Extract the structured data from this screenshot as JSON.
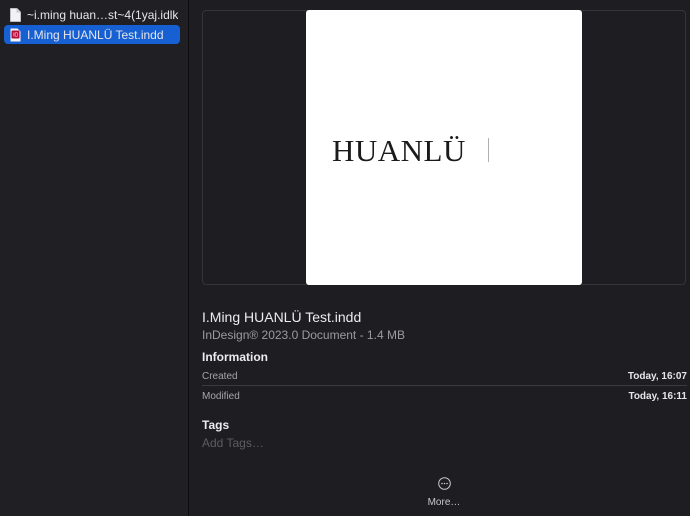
{
  "sidebar": {
    "files": [
      {
        "name": "~i.ming huan…st~4(1yaj.idlk",
        "icon": "generic-document-icon",
        "selected": false
      },
      {
        "name": "I.Ming HUANLÜ Test.indd",
        "icon": "indesign-document-icon",
        "selected": true
      }
    ]
  },
  "preview": {
    "page_text": "HUANLÜ"
  },
  "file": {
    "title": "I.Ming HUANLÜ Test.indd",
    "subtitle": "InDesign® 2023.0 Document - 1.4 MB"
  },
  "information": {
    "heading": "Information",
    "rows": [
      {
        "label": "Created",
        "value": "Today, 16:07"
      },
      {
        "label": "Modified",
        "value": "Today, 16:11"
      }
    ]
  },
  "tags": {
    "heading": "Tags",
    "placeholder": "Add Tags…"
  },
  "more": {
    "label": "More…",
    "icon": "ellipsis-circle-icon"
  },
  "colors": {
    "selection": "#1760d4",
    "indesign_icon": "#b3103b"
  }
}
